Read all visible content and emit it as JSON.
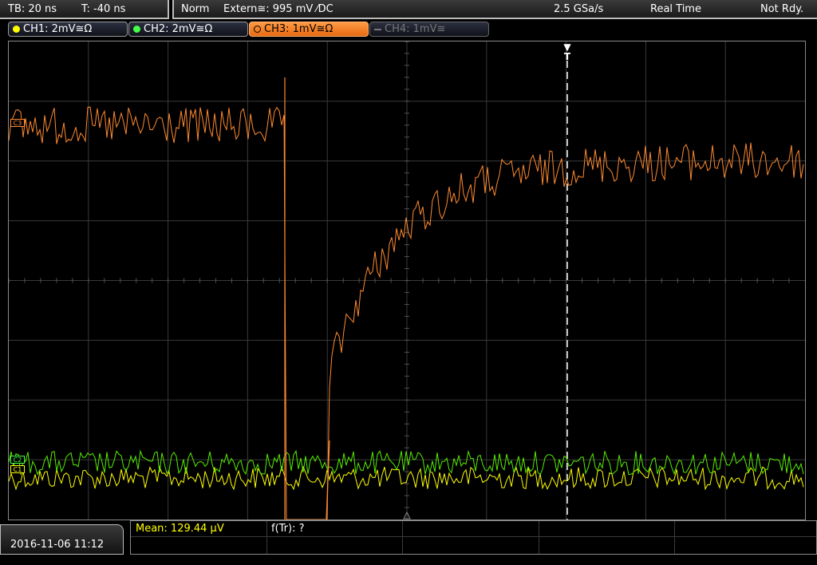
{
  "status_bar": {
    "timebase": "TB: 20 ns",
    "trigger_time": "T: -40 ns",
    "mode": "Norm",
    "trigger_source": "Extern≅: 995 mV ⁄DC",
    "sample_rate": "2.5 GSa/s",
    "acquisition": "Real Time",
    "state": "Not Rdy."
  },
  "channels": [
    {
      "label": "CH1: 2mV≅Ω",
      "color": "#ffff00",
      "state": "on"
    },
    {
      "label": "CH2: 2mV≅Ω",
      "color": "#44ff44",
      "state": "on"
    },
    {
      "label": "CH3: 1mV≅Ω",
      "color": "#ff8a30",
      "state": "active"
    },
    {
      "label": "CH4: 1mV≅",
      "color": "#777777",
      "state": "off"
    }
  ],
  "markers": {
    "trigger": "T",
    "ch3": "C3",
    "ch2": "C2",
    "ch1": "C1"
  },
  "waveforms": {
    "ch3_color": "#ff8a30",
    "ch2_color": "#55ee00",
    "ch1_color": "#ffff00",
    "grid_color": "#3a3a3a"
  },
  "bottom": {
    "datetime": "2016-11-06 11:12",
    "mean_label": "Mean: 129.44 µV",
    "function_label": "f(Tr): ?"
  }
}
